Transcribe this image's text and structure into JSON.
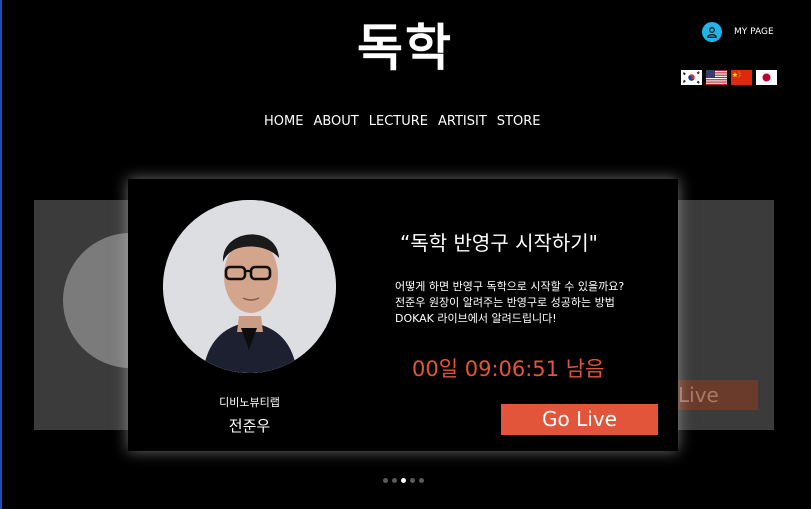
{
  "brand": {
    "logo_text": "독학"
  },
  "header": {
    "mypage_label": "MY PAGE",
    "flags": [
      {
        "icon": "korea-flag-icon"
      },
      {
        "icon": "usa-flag-icon"
      },
      {
        "icon": "china-flag-icon"
      },
      {
        "icon": "japan-flag-icon"
      }
    ]
  },
  "nav": {
    "items": [
      {
        "label": "HOME"
      },
      {
        "label": "ABOUT"
      },
      {
        "label": "LECTURE"
      },
      {
        "label": "ARTISIT"
      },
      {
        "label": "STORE"
      }
    ]
  },
  "carousel": {
    "side_card_button_label": "Live",
    "active_slide": 3,
    "slide_count": 5,
    "card": {
      "affiliation": "디비노뷰티랩",
      "name": "전준우",
      "title": "“독학 반영구 시작하기\"",
      "description_lines": [
        "어떻게 하면 반영구 독학으로 시작할 수 있을까요?",
        "전준우 원장이 알려주는 반영구로 성공하는 방법",
        "DOKAK 라이브에서 알려드립니다!"
      ],
      "countdown": "00일 09:06:51 남음",
      "cta_label": "Go Live"
    }
  },
  "colors": {
    "accent": "#e2553a",
    "user_icon": "#1fb5e8",
    "background": "#000000"
  }
}
